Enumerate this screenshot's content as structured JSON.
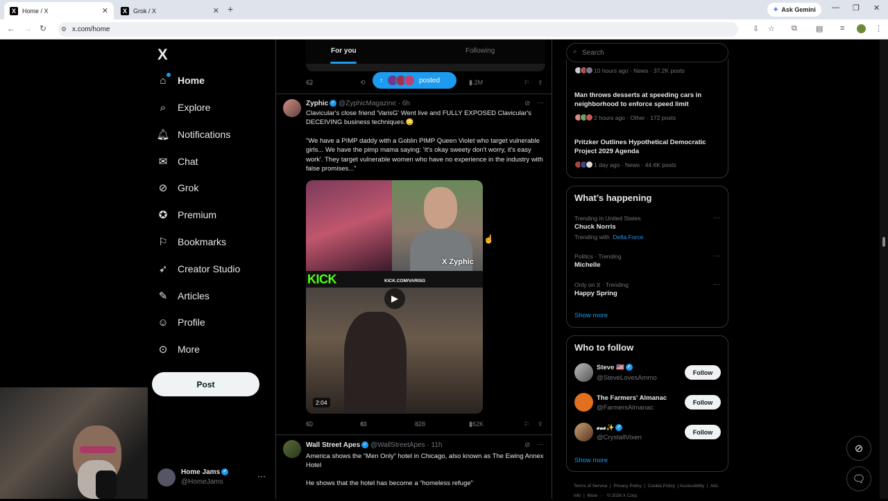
{
  "browser": {
    "tabs": [
      {
        "title": "Home / X"
      },
      {
        "title": "Grok / X"
      }
    ],
    "new_tab": "+",
    "ask_gemini": "Ask Gemini",
    "url": "x.com/home"
  },
  "nav": {
    "brand": "X",
    "items": [
      {
        "label": "Home",
        "icon": "home-icon"
      },
      {
        "label": "Explore",
        "icon": "search-icon"
      },
      {
        "label": "Notifications",
        "icon": "bell-icon"
      },
      {
        "label": "Chat",
        "icon": "mail-icon"
      },
      {
        "label": "Grok",
        "icon": "grok-icon"
      },
      {
        "label": "Premium",
        "icon": "premium-icon"
      },
      {
        "label": "Bookmarks",
        "icon": "bookmark-icon"
      },
      {
        "label": "Creator Studio",
        "icon": "rocket-icon"
      },
      {
        "label": "Articles",
        "icon": "article-icon"
      },
      {
        "label": "Profile",
        "icon": "person-icon"
      },
      {
        "label": "More",
        "icon": "more-icon"
      }
    ],
    "post_button": "Post",
    "account": {
      "name": "Home Jams",
      "handle": "@HomeJams"
    }
  },
  "timeline": {
    "tabs": [
      "For you",
      "Following"
    ],
    "posted_pill": "posted",
    "prev_tweet_actions": {
      "replies": "62",
      "views": "3.2M"
    },
    "tweets": [
      {
        "name": "Zyphic",
        "handle": "@ZyphicMagazine",
        "time": "· 6h",
        "text1": "Clavicular's close friend 'VarisG' Went live and FULLY EXPOSED Clavicular's DECEIVING business techniques.😳",
        "text2": "\"We have a PIMP daddy with a Goblin PIMP Queen Violet who target vulnerable girls... We have the pimp mama saying: 'It's okay sweety don't worry, it's easy work'.  They target vulnerable women who have no experience in the industry with false promises...\"",
        "media": {
          "watermark": "X Zyphic",
          "kick_logo": "KICK",
          "kick_url": "KICK.COM/VARISG",
          "duration": "2:04"
        },
        "replies": "60",
        "reposts": "63",
        "likes": "828",
        "views": "262K"
      },
      {
        "name": "Wall Street Apes",
        "handle": "@WallStreetApes",
        "time": "· 11h",
        "text1": "America shows the “Men Only” hotel in Chicago, also known as The Ewing Annex Hotel",
        "text2": "He shows that the hotel has become a “homeless refuge”"
      }
    ]
  },
  "rail": {
    "search_placeholder": "Search",
    "news": [
      {
        "meta": "10 hours ago · News · 37.2K posts"
      },
      {
        "title": "Man throws desserts at speeding cars in neighborhood to enforce speed limit",
        "meta": "2 hours ago · Other · 172 posts"
      },
      {
        "title": "Pritzker Outlines Hypothetical Democratic Project 2029 Agenda",
        "meta": "1 day ago · News · 44.6K posts"
      }
    ],
    "happening": {
      "title": "What’s happening",
      "trends": [
        {
          "context": "Trending in United States",
          "name": "Chuck Norris",
          "with_label": "Trending with",
          "with_link": "Delta Force"
        },
        {
          "context": "Politics · Trending",
          "name": "Michelle"
        },
        {
          "context": "Only on X · Trending",
          "name": "Happy Spring"
        }
      ],
      "show_more": "Show more"
    },
    "who_to_follow": {
      "title": "Who to follow",
      "users": [
        {
          "name": "Steve 🇺🇸",
          "handle": "@SteveLovesAmmo",
          "button": "Follow"
        },
        {
          "name": "The Farmers' Almanac",
          "handle": "@FarmersAlmanac",
          "button": "Follow"
        },
        {
          "name": "𝓮𝓿𝓮✨",
          "handle": "@CrystallVixen",
          "button": "Follow"
        }
      ],
      "show_more": "Show more"
    },
    "footer": {
      "links": [
        "Terms of Service",
        "Privacy Policy",
        "Cookie Policy",
        "Accessibility",
        "Ads info",
        "More ···",
        "© 2026 X Corp."
      ]
    }
  },
  "colors": {
    "accent": "#1d9bf0",
    "background": "#000000",
    "border": "#2f3336",
    "muted": "#71767b",
    "kick_green": "#53fc18"
  }
}
